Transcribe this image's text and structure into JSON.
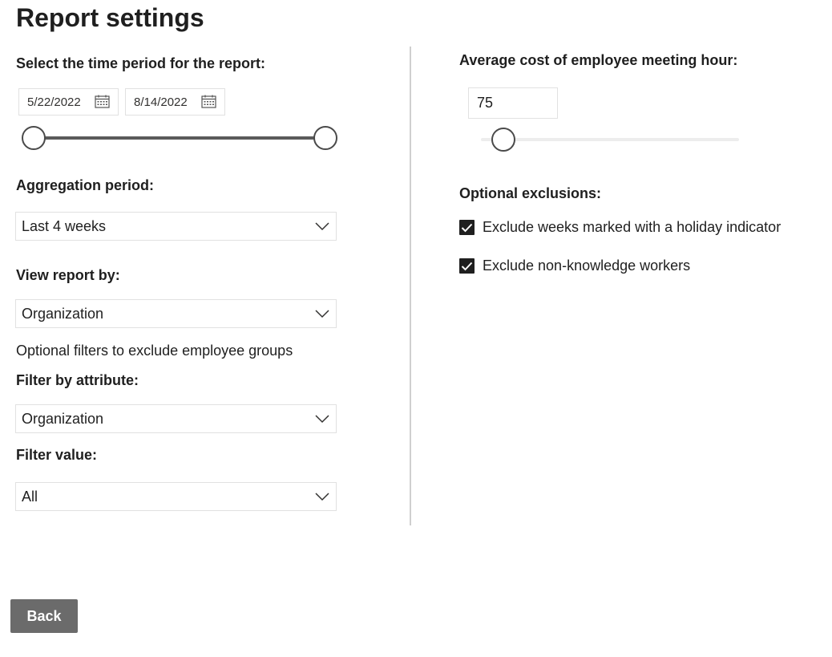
{
  "page_title": "Report settings",
  "time_period": {
    "label": "Select the time period for the report:",
    "start_date": "5/22/2022",
    "end_date": "8/14/2022",
    "calendar_icon": "calendar-icon",
    "slider_start_fraction": 0.0,
    "slider_end_fraction": 1.0
  },
  "aggregation": {
    "label": "Aggregation period:",
    "value": "Last 4 weeks"
  },
  "view_by": {
    "label": "View report by:",
    "value": "Organization"
  },
  "filters_note": "Optional filters to exclude employee groups",
  "filter_attribute": {
    "label": "Filter by attribute:",
    "value": "Organization"
  },
  "filter_value": {
    "label": "Filter value:",
    "value": "All"
  },
  "meeting_cost": {
    "label": "Average cost of employee meeting hour:",
    "value": "75",
    "slider_fraction": 0.0
  },
  "exclusions": {
    "label": "Optional exclusions:",
    "items": [
      {
        "label": "Exclude weeks marked with a holiday indicator",
        "checked": true
      },
      {
        "label": "Exclude non-knowledge workers",
        "checked": true
      }
    ]
  },
  "back_button": "Back",
  "colors": {
    "text": "#1f1f1f",
    "button_bg": "#6b6b6b",
    "border": "#e1e1e1",
    "slider_track": "#5b5b5b"
  }
}
